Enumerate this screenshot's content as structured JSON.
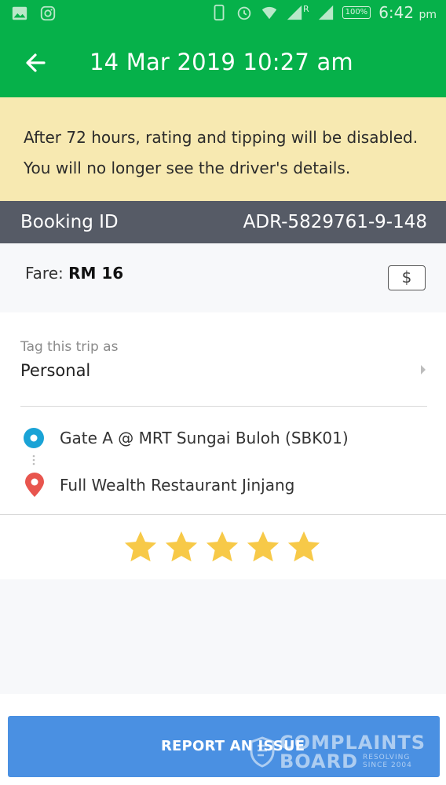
{
  "status_bar": {
    "left_icons": [
      "gallery-icon",
      "instagram-icon"
    ],
    "right_icons": [
      "phone-icon",
      "alarm-icon",
      "wifi-icon",
      "signal-icon",
      "signal-icon"
    ],
    "roaming_letter": "R",
    "battery": "100%",
    "time": "6:42",
    "ampm": "pm"
  },
  "app_bar": {
    "title": "14 Mar 2019 10:27 am",
    "back_icon": "arrow-left-icon"
  },
  "notice": {
    "line1": "After 72 hours, rating and tipping will be disabled.",
    "line2": "You will no longer see the driver's details."
  },
  "booking": {
    "label": "Booking ID",
    "value": "ADR-5829761-9-148"
  },
  "fare": {
    "label": "Fare:",
    "value": "RM 16",
    "tip_button": "$"
  },
  "tag": {
    "label": "Tag this trip as",
    "value": "Personal"
  },
  "route": {
    "pickup": "Gate A @ MRT Sungai Buloh (SBK01)",
    "dropoff": "Full Wealth Restaurant Jinjang"
  },
  "rating": {
    "value": 5,
    "max": 5
  },
  "footer": {
    "report_button": "REPORT AN ISSUE"
  },
  "watermark": {
    "line1": "COMPLAINTS",
    "line2": "BOARD",
    "tag1": "RESOLVING",
    "tag2": "SINCE 2004"
  },
  "colors": {
    "brand_green": "#06b14a",
    "notice_bg": "#f7e9b1",
    "booking_bar": "#565b66",
    "pickup_blue": "#1aa3d6",
    "dropoff_red": "#e8554e",
    "star_gold": "#f7c948",
    "report_blue": "#4a90e2"
  }
}
